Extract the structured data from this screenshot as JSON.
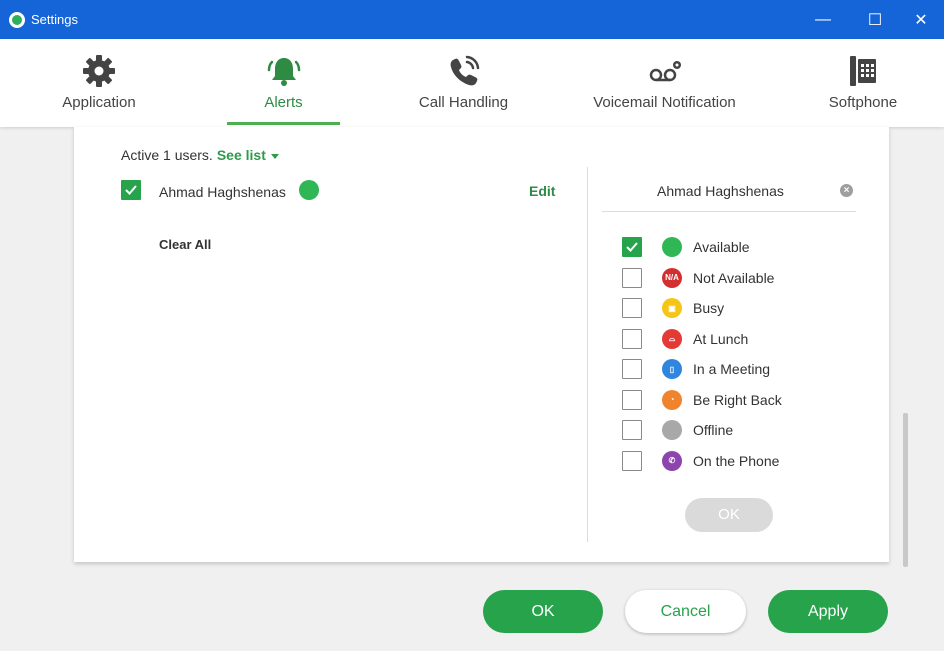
{
  "window": {
    "title": "Settings",
    "minimize": "—",
    "maximize": "☐",
    "close": "✕"
  },
  "tabs": [
    {
      "label": "Application",
      "icon": "gear-icon"
    },
    {
      "label": "Alerts",
      "icon": "bell-icon",
      "active": true
    },
    {
      "label": "Call Handling",
      "icon": "phone-ringing-icon"
    },
    {
      "label": "Voicemail Notification",
      "icon": "voicemail-icon"
    },
    {
      "label": "Softphone",
      "icon": "desk-phone-icon"
    }
  ],
  "alerts": {
    "active_text": "Active 1 users.",
    "see_list": "See list",
    "user": {
      "name": "Ahmad Haghshenas",
      "checked": true,
      "status_color": "#2fb655"
    },
    "edit": "Edit",
    "clear_all": "Clear All"
  },
  "panel": {
    "name": "Ahmad Haghshenas",
    "close": "×",
    "statuses": [
      {
        "label": "Available",
        "checked": true,
        "color": "#2fb655",
        "glyph": ""
      },
      {
        "label": "Not Available",
        "checked": false,
        "color": "#d32f2f",
        "glyph": "N/A"
      },
      {
        "label": "Busy",
        "checked": false,
        "color": "#f5c518",
        "glyph": "▣"
      },
      {
        "label": "At Lunch",
        "checked": false,
        "color": "#e53935",
        "glyph": "⌓"
      },
      {
        "label": "In a Meeting",
        "checked": false,
        "color": "#2e86de",
        "glyph": "▯"
      },
      {
        "label": "Be Right Back",
        "checked": false,
        "color": "#f0842c",
        "glyph": "◔"
      },
      {
        "label": "Offline",
        "checked": false,
        "color": "#a8a8a8",
        "glyph": ""
      },
      {
        "label": "On the Phone",
        "checked": false,
        "color": "#8e44ad",
        "glyph": "✆"
      }
    ],
    "ok": "OK"
  },
  "footer": {
    "ok": "OK",
    "cancel": "Cancel",
    "apply": "Apply"
  }
}
